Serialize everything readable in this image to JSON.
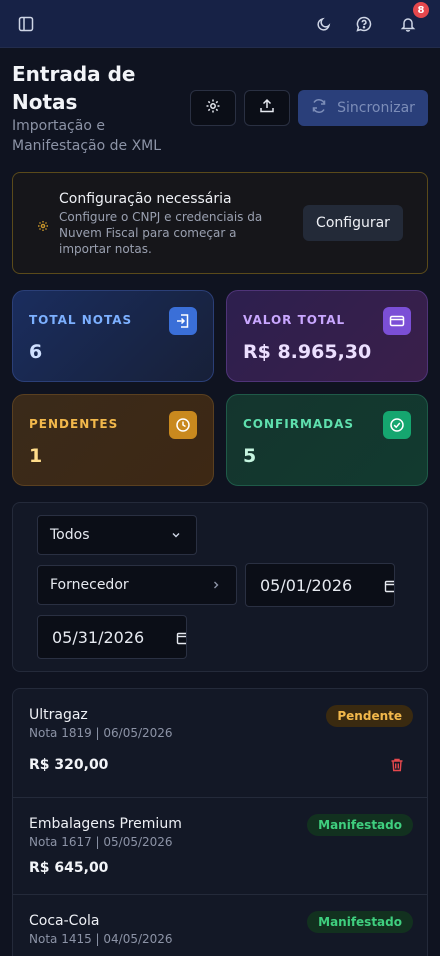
{
  "header": {
    "notification_count": "8"
  },
  "page": {
    "title": "Entrada de Notas",
    "subtitle": "Importação e Manifestação de XML"
  },
  "actions": {
    "sync_label": "Sincronizar"
  },
  "config_notice": {
    "title": "Configuração necessária",
    "description": "Configure o CNPJ e credenciais da Nuvem Fiscal para começar a importar notas.",
    "button_label": "Configurar"
  },
  "stats": [
    {
      "label": "TOTAL NOTAS",
      "value": "6",
      "color": "#7cb0ff"
    },
    {
      "label": "VALOR TOTAL",
      "value": "R$ 8.965,30",
      "color": "#c9a7ff"
    },
    {
      "label": "PENDENTES",
      "value": "1",
      "color": "#f2b84b"
    },
    {
      "label": "CONFIRMADAS",
      "value": "5",
      "color": "#5fe0ae"
    }
  ],
  "filters": {
    "status_selected": "Todos",
    "supplier_label": "Fornecedor",
    "date_from": "05/01/2026",
    "date_to": "05/31/2026"
  },
  "notes": [
    {
      "supplier": "Ultragaz",
      "meta": "Nota 1819 | 06/05/2026",
      "amount": "R$ 320,00",
      "status": "Pendente"
    },
    {
      "supplier": "Embalagens Premium",
      "meta": "Nota 1617 | 05/05/2026",
      "amount": "R$ 645,00",
      "status": "Manifestado"
    },
    {
      "supplier": "Coca-Cola",
      "meta": "Nota 1415 | 04/05/2026",
      "amount": "",
      "status": "Manifestado"
    }
  ],
  "icons": {
    "sidebar": "sidebar-toggle-icon",
    "theme": "moon-icon",
    "help": "help-chat-icon",
    "bell": "bell-icon",
    "settings": "gear-icon",
    "upload": "upload-icon",
    "sync": "refresh-icon",
    "warning": "gear-warning-icon",
    "delete": "trash-icon"
  }
}
